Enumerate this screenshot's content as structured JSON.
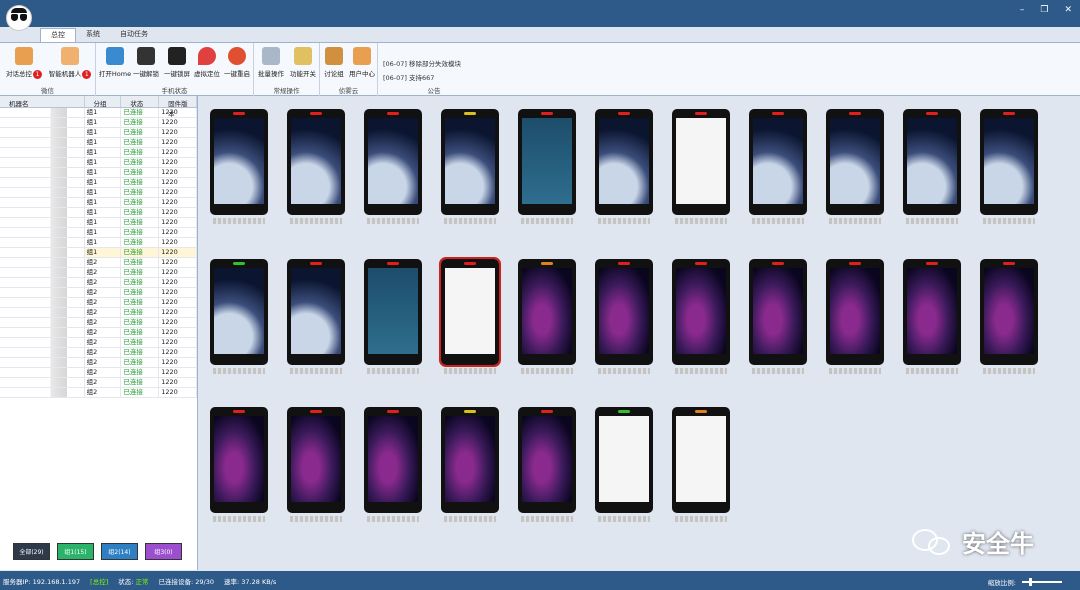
{
  "tabs": [
    "总控",
    "系统",
    "自动任务"
  ],
  "ribbon": {
    "groups": [
      {
        "label": "微信",
        "buttons": [
          {
            "label": "对话总控",
            "badge": "1"
          },
          {
            "label": "智能机器人",
            "badge": "1"
          }
        ]
      },
      {
        "label": "手机状态",
        "buttons": [
          {
            "label": "打开Home"
          },
          {
            "label": "一键解锁"
          },
          {
            "label": "一键锁屏"
          },
          {
            "label": "虚拟定位"
          },
          {
            "label": "一键重启"
          }
        ]
      },
      {
        "label": "常规操作",
        "buttons": [
          {
            "label": "批量操作"
          },
          {
            "label": "功能开关"
          }
        ]
      },
      {
        "label": "侦雾云",
        "buttons": [
          {
            "label": "讨论组"
          },
          {
            "label": "用户中心"
          }
        ]
      },
      {
        "label": "公告",
        "notices": [
          "[06-07] 移除部分失效模块",
          "[06-07] 支持667"
        ]
      }
    ]
  },
  "table": {
    "headers": [
      "机器名",
      "分组",
      "状态",
      "固件版本"
    ],
    "rows": [
      {
        "group": "组1",
        "status": "已连接",
        "fw": "1220"
      },
      {
        "group": "组1",
        "status": "已连接",
        "fw": "1220"
      },
      {
        "group": "组1",
        "status": "已连接",
        "fw": "1220"
      },
      {
        "group": "组1",
        "status": "已连接",
        "fw": "1220"
      },
      {
        "group": "组1",
        "status": "已连接",
        "fw": "1220"
      },
      {
        "group": "组1",
        "status": "已连接",
        "fw": "1220"
      },
      {
        "group": "组1",
        "status": "已连接",
        "fw": "1220"
      },
      {
        "group": "组1",
        "status": "已连接",
        "fw": "1220"
      },
      {
        "group": "组1",
        "status": "已连接",
        "fw": "1220"
      },
      {
        "group": "组1",
        "status": "已连接",
        "fw": "1220"
      },
      {
        "group": "组1",
        "status": "已连接",
        "fw": "1220"
      },
      {
        "group": "组1",
        "status": "已连接",
        "fw": "1220"
      },
      {
        "group": "组1",
        "status": "已连接",
        "fw": "1220"
      },
      {
        "group": "组1",
        "status": "已连接",
        "fw": "1220"
      },
      {
        "group": "组1",
        "status": "已连接",
        "fw": "1220"
      },
      {
        "group": "组2",
        "status": "已连接",
        "fw": "1220"
      },
      {
        "group": "组2",
        "status": "已连接",
        "fw": "1220"
      },
      {
        "group": "组2",
        "status": "已连接",
        "fw": "1220"
      },
      {
        "group": "组2",
        "status": "已连接",
        "fw": "1220"
      },
      {
        "group": "组2",
        "status": "已连接",
        "fw": "1220"
      },
      {
        "group": "组2",
        "status": "已连接",
        "fw": "1220"
      },
      {
        "group": "组2",
        "status": "已连接",
        "fw": "1220"
      },
      {
        "group": "组2",
        "status": "已连接",
        "fw": "1220"
      },
      {
        "group": "组2",
        "status": "已连接",
        "fw": "1220"
      },
      {
        "group": "组2",
        "status": "已连接",
        "fw": "1220"
      },
      {
        "group": "组2",
        "status": "已连接",
        "fw": "1220"
      },
      {
        "group": "组2",
        "status": "已连接",
        "fw": "1220"
      },
      {
        "group": "组2",
        "status": "已连接",
        "fw": "1220"
      },
      {
        "group": "组2",
        "status": "已连接",
        "fw": "1220"
      }
    ]
  },
  "filters": [
    {
      "label": "全部(29)",
      "color": "#2e3a4a"
    },
    {
      "label": "组1(15)",
      "color": "#2bb36a"
    },
    {
      "label": "组2(14)",
      "color": "#2f7fc4"
    },
    {
      "label": "组3(0)",
      "color": "#9b4fcf"
    }
  ],
  "phones": [
    {
      "screen": "space",
      "led": "#e02020"
    },
    {
      "screen": "space",
      "led": "#e02020"
    },
    {
      "screen": "space",
      "led": "#e02020"
    },
    {
      "screen": "space",
      "led": "#d8c020"
    },
    {
      "screen": "teal",
      "led": "#e02020"
    },
    {
      "screen": "space",
      "led": "#e02020"
    },
    {
      "screen": "white",
      "led": "#e02020"
    },
    {
      "screen": "space",
      "led": "#e02020"
    },
    {
      "screen": "space",
      "led": "#e02020"
    },
    {
      "screen": "space",
      "led": "#e02020"
    },
    {
      "screen": "space",
      "led": "#e02020"
    },
    {
      "screen": "space",
      "led": "#30c030"
    },
    {
      "screen": "space",
      "led": "#e02020"
    },
    {
      "screen": "teal",
      "led": "#e02020"
    },
    {
      "screen": "white",
      "led": "#e02020",
      "selected": true
    },
    {
      "screen": "ribbon-bg",
      "led": "#e08020"
    },
    {
      "screen": "ribbon-bg",
      "led": "#e02020"
    },
    {
      "screen": "ribbon-bg",
      "led": "#e02020"
    },
    {
      "screen": "ribbon-bg",
      "led": "#e02020"
    },
    {
      "screen": "ribbon-bg",
      "led": "#e02020"
    },
    {
      "screen": "ribbon-bg",
      "led": "#e02020"
    },
    {
      "screen": "ribbon-bg",
      "led": "#e02020"
    },
    {
      "screen": "ribbon-bg",
      "led": "#e02020"
    },
    {
      "screen": "ribbon-bg",
      "led": "#e02020"
    },
    {
      "screen": "ribbon-bg",
      "led": "#e02020"
    },
    {
      "screen": "ribbon-bg",
      "led": "#d8c020"
    },
    {
      "screen": "ribbon-bg",
      "led": "#e02020"
    },
    {
      "screen": "white",
      "led": "#30c030"
    },
    {
      "screen": "white",
      "led": "#e08020"
    }
  ],
  "status": {
    "server": "服务器IP: 192.168.1.197",
    "role": "[总控]",
    "state_label": "状态:",
    "state_value": "正常",
    "connected": "已连接设备: 29/30",
    "speed": "速率: 37.28 KB/s",
    "zoom_label": "缩放比例:",
    "zoom_level": 0.18
  },
  "watermark": "安全牛"
}
